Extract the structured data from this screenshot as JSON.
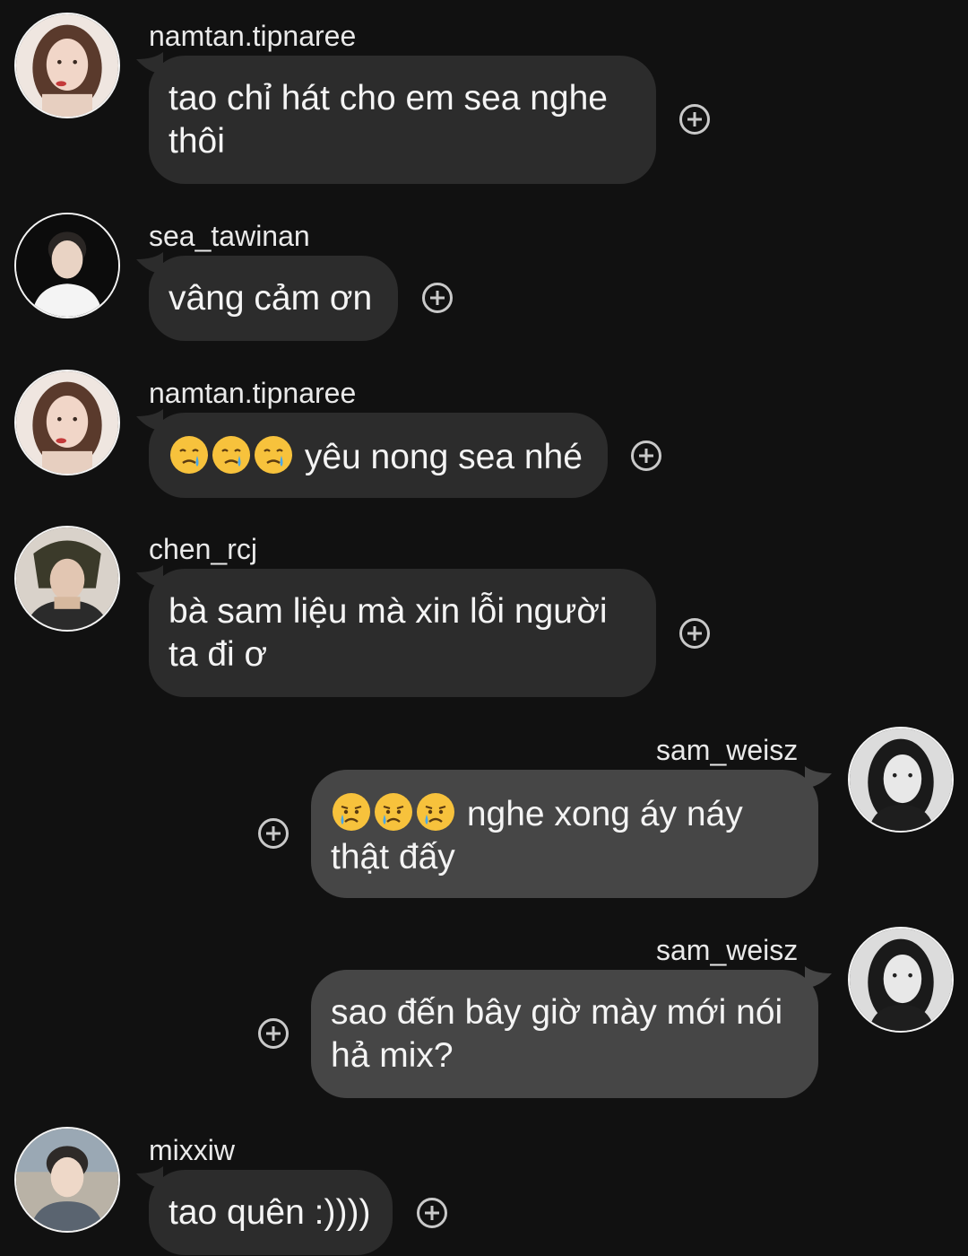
{
  "messages": [
    {
      "username": "namtan.tipnaree",
      "text": "tao chỉ hát cho em sea nghe thôi",
      "avatar": "woman-portrait-avatar",
      "side": "left"
    },
    {
      "username": "sea_tawinan",
      "text": "vâng cảm ơn",
      "avatar": "man-portrait-avatar",
      "side": "left"
    },
    {
      "username": "namtan.tipnaree",
      "text": " yêu nong sea nhé",
      "emoji": "crying-face-emoji",
      "emoji_count": 3,
      "avatar": "woman-portrait-avatar",
      "side": "left"
    },
    {
      "username": "chen_rcj",
      "text": "bà sam liệu mà xin lỗi người ta đi ơ",
      "avatar": "man-portrait-avatar",
      "side": "left"
    },
    {
      "username": "sam_weisz",
      "text": " nghe xong áy náy thật đấy",
      "emoji": "sad-tear-face-emoji",
      "emoji_count": 3,
      "avatar": "woman-bw-portrait-avatar",
      "side": "right"
    },
    {
      "username": "sam_weisz",
      "text": "sao đến bây giờ mày mới nói hả mix?",
      "avatar": "woman-bw-portrait-avatar",
      "side": "right"
    },
    {
      "username": "mixxiw",
      "text": "tao quên :))))",
      "avatar": "man-portrait-avatar",
      "side": "left"
    }
  ],
  "icons": {
    "add_reaction": "plus-circle-icon"
  },
  "colors": {
    "background": "#111111",
    "incoming_bubble": "#2c2c2c",
    "outgoing_bubble": "#464646",
    "text": "#f4f4f4"
  }
}
